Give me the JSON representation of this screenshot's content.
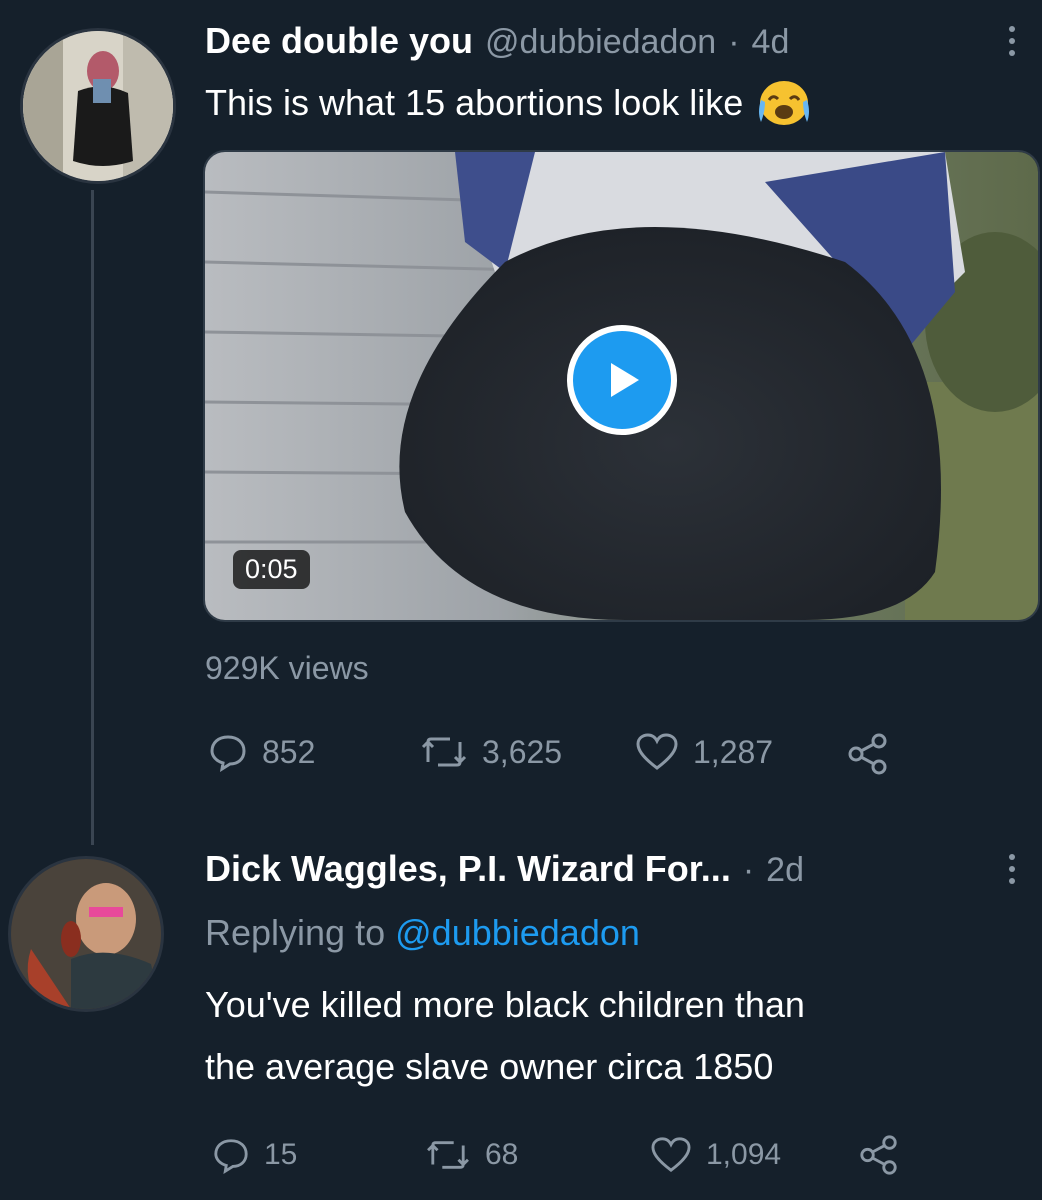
{
  "tweet": {
    "display_name": "Dee double you",
    "handle": "@dubbiedadon",
    "separator": "·",
    "age": "4d",
    "text": "This is what 15 abortions look like",
    "emoji_icon": "crying-face-emoji",
    "video": {
      "duration": "0:05",
      "play_icon": "play-icon"
    },
    "views": "929K views",
    "actions": {
      "replies": "852",
      "retweets": "3,625",
      "likes": "1,287"
    }
  },
  "reply": {
    "display_name": "Dick Waggles, P.I. Wizard For...",
    "separator": "·",
    "age": "2d",
    "replying_prefix": "Replying to",
    "replying_handle": "@dubbiedadon",
    "text_line1": "You've killed more black children than",
    "text_line2": "the average slave owner circa 1850",
    "actions": {
      "replies": "15",
      "retweets": "68",
      "likes": "1,094"
    }
  },
  "colors": {
    "background": "#15202b",
    "accent": "#1d9bf0",
    "muted": "#8b98a5"
  }
}
